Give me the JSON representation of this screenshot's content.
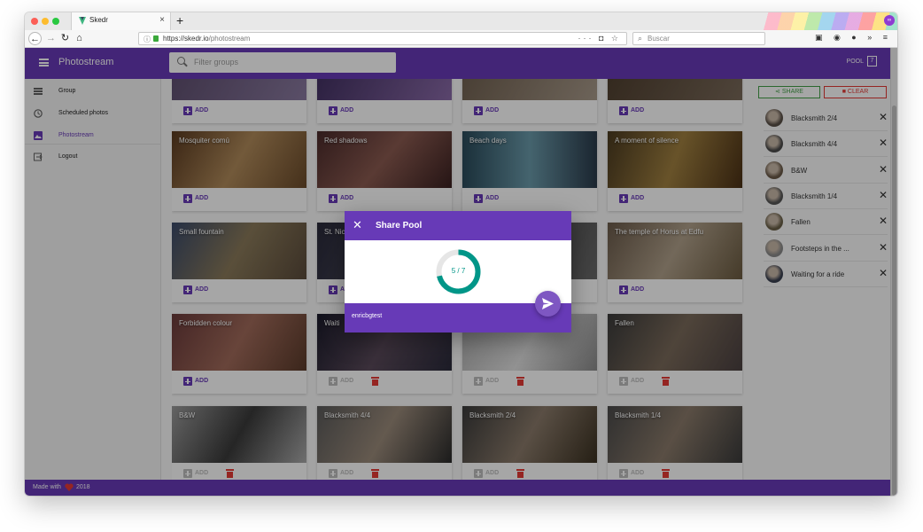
{
  "browser": {
    "tab_title": "Skedr",
    "new_tab": "+",
    "url_host": "https://skedr.io",
    "url_path": "/photostream",
    "search_placeholder": "Buscar",
    "url_icons": "··· ◘ ☆"
  },
  "app": {
    "title": "Photostream",
    "filter_placeholder": "Filter groups",
    "pool_label": "POOL",
    "pool_count": "7"
  },
  "sidebar": {
    "items": [
      {
        "label": "Group",
        "icon": "group-icon"
      },
      {
        "label": "Scheduled photos",
        "icon": "clock-icon"
      },
      {
        "label": "Photostream",
        "icon": "photo-icon"
      },
      {
        "label": "Logout",
        "icon": "logout-icon"
      }
    ]
  },
  "add_label": "ADD",
  "cards": [
    {
      "title": "",
      "gradient": "linear-gradient(120deg,#5a4a6a,#8a7aa0)"
    },
    {
      "title": "",
      "gradient": "linear-gradient(120deg,#3a2a5a,#8a6aa8)"
    },
    {
      "title": "",
      "gradient": "linear-gradient(120deg,#6a5a4a,#a89a8a)"
    },
    {
      "title": "",
      "gradient": "linear-gradient(120deg,#4a3a2a,#7a6a5a)"
    },
    {
      "title": "Mosquiter comú",
      "gradient": "linear-gradient(120deg,#5a3a20,#b08a5a 50%,#6a4a2a)"
    },
    {
      "title": "Red shadows",
      "gradient": "linear-gradient(130deg,#4a2a2a,#8a5a50 50%,#3a2020)"
    },
    {
      "title": "Beach days",
      "gradient": "linear-gradient(90deg,#2a4a5a,#6a9aaa 50%,#2a3a4a)"
    },
    {
      "title": "A moment of silence",
      "gradient": "linear-gradient(110deg,#4a3a20,#a08040 50%,#4a3015)"
    },
    {
      "title": "Small fountain",
      "gradient": "linear-gradient(120deg,#3a4a6a,#8a7a5a 50%,#5a4a3a)"
    },
    {
      "title": "St. Nic",
      "gradient": "linear-gradient(120deg,#2a2a3a,#5a5a6a)"
    },
    {
      "title": "",
      "gradient": "linear-gradient(120deg,#3a3a3a,#6a6a6a)"
    },
    {
      "title": "The temple of Horus at Edfu",
      "gradient": "linear-gradient(120deg,#6a5a4a,#b0a08a 50%,#6a5a40)"
    },
    {
      "title": "Forbidden colour",
      "gradient": "linear-gradient(120deg,#6a3a3a,#a06a5a 50%,#5a3a2a)"
    },
    {
      "title": "Waiti",
      "gradient": "linear-gradient(120deg,#1a1a2a,#5a4a5a 50%,#2a2a3a)"
    },
    {
      "title": "",
      "gradient": "linear-gradient(120deg,#aaaaaa,#e0e0e0 50%,#8a8a8a)"
    },
    {
      "title": "Fallen",
      "gradient": "linear-gradient(120deg,#3a3a3a,#7a6a5a 50%,#4a4040)"
    },
    {
      "title": "B&W",
      "gradient": "linear-gradient(120deg,#9a9a9a,#3a3a3a 50%,#aaaaaa)"
    },
    {
      "title": "Blacksmith 4/4",
      "gradient": "linear-gradient(120deg,#5a5a5a,#9a8a7a 50%,#2a2a2a)"
    },
    {
      "title": "Blacksmith 2/4",
      "gradient": "linear-gradient(120deg,#3a3a3a,#8a7a6a 50%,#3a3020)"
    },
    {
      "title": "Blacksmith 1/4",
      "gradient": "linear-gradient(120deg,#4a4a4a,#8a7a6a 50%,#3a3a3a)"
    }
  ],
  "pool": {
    "share_label": "SHARE",
    "clear_label": "CLEAR",
    "items": [
      {
        "name": "Blacksmith 2/4"
      },
      {
        "name": "Blacksmith 4/4"
      },
      {
        "name": "B&W"
      },
      {
        "name": "Blacksmith 1/4"
      },
      {
        "name": "Fallen"
      },
      {
        "name": "Footsteps in the ..."
      },
      {
        "name": "Waiting for a ride"
      }
    ]
  },
  "dialog": {
    "title": "Share Pool",
    "progress_text": "5 / 7",
    "progress_fraction": 0.714,
    "username": "enricbgtest"
  },
  "footer": {
    "made_with": "Made with",
    "year": "2018"
  },
  "colors": {
    "primary": "#673ab7",
    "teal": "#009688",
    "danger": "#e53935",
    "success": "#43a047"
  }
}
